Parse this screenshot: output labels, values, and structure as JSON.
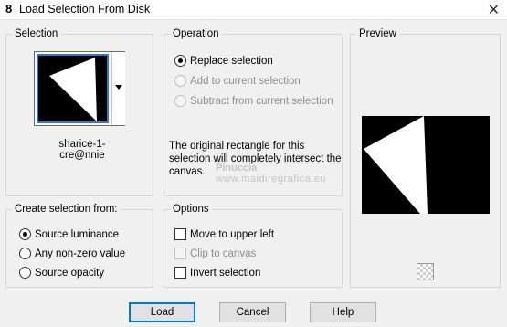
{
  "window": {
    "icon_text": "8",
    "title": "Load Selection From Disk",
    "close_symbol": "✕"
  },
  "selection_group": {
    "label": "Selection",
    "file_name": "sharice-1-cre@nnie"
  },
  "operation_group": {
    "label": "Operation",
    "options": [
      {
        "label": "Replace selection",
        "checked": true,
        "enabled": true
      },
      {
        "label": "Add to current selection",
        "checked": false,
        "enabled": false
      },
      {
        "label": "Subtract from current selection",
        "checked": false,
        "enabled": false
      }
    ],
    "info_text": "The original rectangle for this selection will completely intersect the canvas."
  },
  "preview_group": {
    "label": "Preview",
    "checker_icon": "transparency-checker-icon"
  },
  "create_group": {
    "label": "Create selection from:",
    "options": [
      {
        "label": "Source luminance",
        "checked": true
      },
      {
        "label": "Any non-zero value",
        "checked": false
      },
      {
        "label": "Source opacity",
        "checked": false
      }
    ]
  },
  "options_group": {
    "label": "Options",
    "checkboxes": [
      {
        "label": "Move to upper left",
        "checked": false,
        "enabled": true
      },
      {
        "label": "Clip to canvas",
        "checked": false,
        "enabled": false
      },
      {
        "label": "Invert selection",
        "checked": false,
        "enabled": true
      }
    ]
  },
  "buttons": {
    "load": "Load",
    "cancel": "Cancel",
    "help": "Help"
  },
  "watermark": {
    "line1": "Pinuccia",
    "line2": "www.maidiregrafica.eu"
  },
  "colors": {
    "focus_blue": "#2a7ad9",
    "dialog_bg": "#f0f0f0"
  }
}
